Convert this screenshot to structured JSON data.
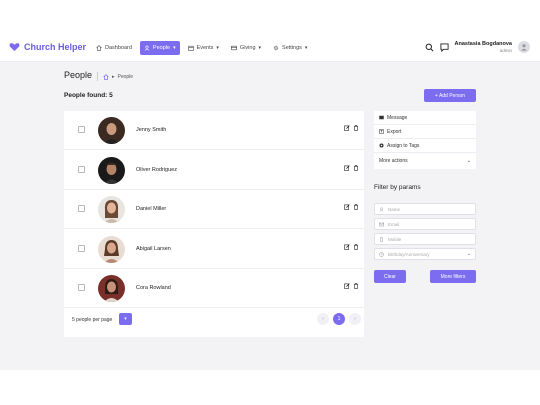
{
  "app": {
    "name": "Church Helper",
    "brand_color": "#7b6cf0"
  },
  "nav": [
    {
      "label": "Dashboard",
      "icon": "home-icon",
      "active": false,
      "dropdown": false
    },
    {
      "label": "People",
      "icon": "user-icon",
      "active": true,
      "dropdown": true
    },
    {
      "label": "Events",
      "icon": "calendar-icon",
      "active": false,
      "dropdown": true
    },
    {
      "label": "Giving",
      "icon": "card-icon",
      "active": false,
      "dropdown": true
    },
    {
      "label": "Settings",
      "icon": "gear-icon",
      "active": false,
      "dropdown": true
    }
  ],
  "user": {
    "name": "Anastasia Bogdanova",
    "role": "admin"
  },
  "page": {
    "title": "People",
    "breadcrumb": "People",
    "found": "People found: 5",
    "add_button": "+ Add Person"
  },
  "people": [
    {
      "name": "Jenny Smith"
    },
    {
      "name": "Oliver Rodriguez"
    },
    {
      "name": "Daniel Miller"
    },
    {
      "name": "Abigail Larsen"
    },
    {
      "name": "Cora Rowland"
    }
  ],
  "footer": {
    "per_page": "5 people per page",
    "current_page": "1"
  },
  "actions": {
    "message": "Message",
    "export": "Export",
    "assign": "Assign to Tags",
    "more": "More actions"
  },
  "filters": {
    "title": "Filter by params",
    "name_placeholder": "Name",
    "email_placeholder": "Email",
    "mobile_placeholder": "Mobile",
    "birthday_placeholder": "Birthday/Anniversary",
    "clear": "Clear",
    "more": "More filters"
  }
}
